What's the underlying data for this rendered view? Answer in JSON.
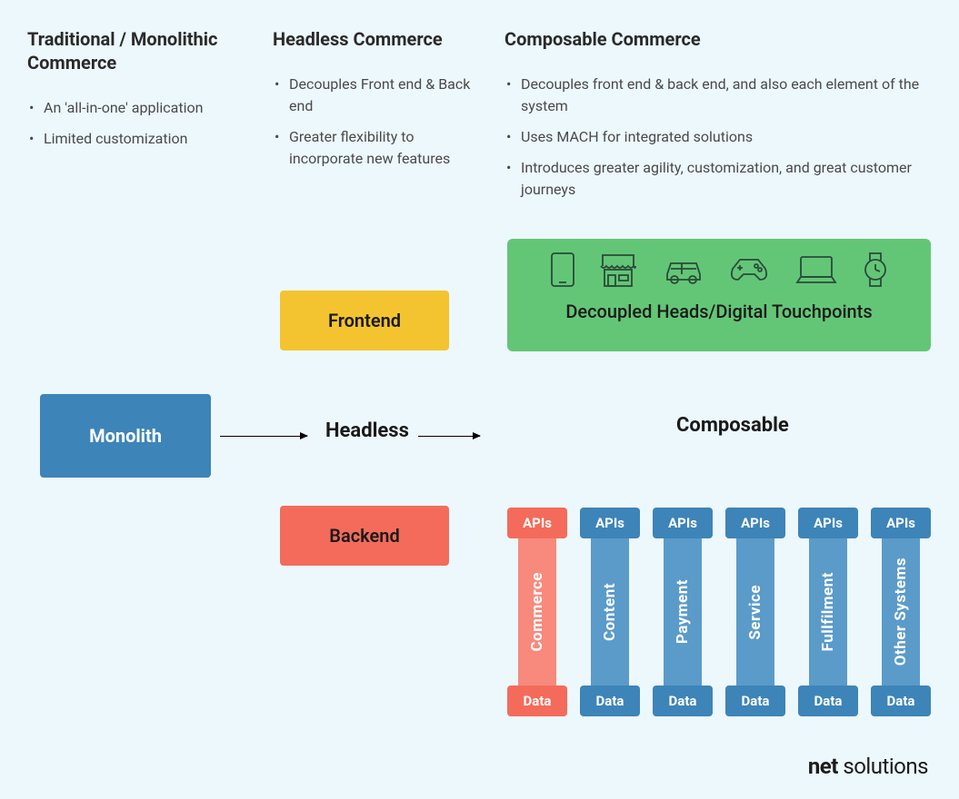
{
  "columns": {
    "traditional": {
      "title": "Traditional / Monolithic Commerce",
      "bullets": [
        "An 'all-in-one' application",
        "Limited customization"
      ]
    },
    "headless": {
      "title": "Headless Commerce",
      "bullets": [
        "Decouples Front end & Back end",
        "Greater flexibility to incorporate new features"
      ]
    },
    "composable": {
      "title": "Composable Commerce",
      "bullets": [
        "Decouples front end & back end, and also each element of the system",
        "Uses MACH for integrated solutions",
        "Introduces greater agility, customization, and great customer journeys"
      ]
    }
  },
  "touchpoints_label": "Decoupled Heads/Digital Touchpoints",
  "frontend_label": "Frontend",
  "backend_label": "Backend",
  "monolith_label": "Monolith",
  "headless_label": "Headless",
  "composable_label": "Composable",
  "api_label": "APIs",
  "data_label": "Data",
  "pillars": [
    {
      "name": "Commerce",
      "color": "red"
    },
    {
      "name": "Content",
      "color": "blue"
    },
    {
      "name": "Payment",
      "color": "blue"
    },
    {
      "name": "Service",
      "color": "blue"
    },
    {
      "name": "Fullfilment",
      "color": "blue"
    },
    {
      "name": "Other Systems",
      "color": "blue"
    }
  ],
  "brand": {
    "bold": "net",
    "light": " solutions"
  }
}
